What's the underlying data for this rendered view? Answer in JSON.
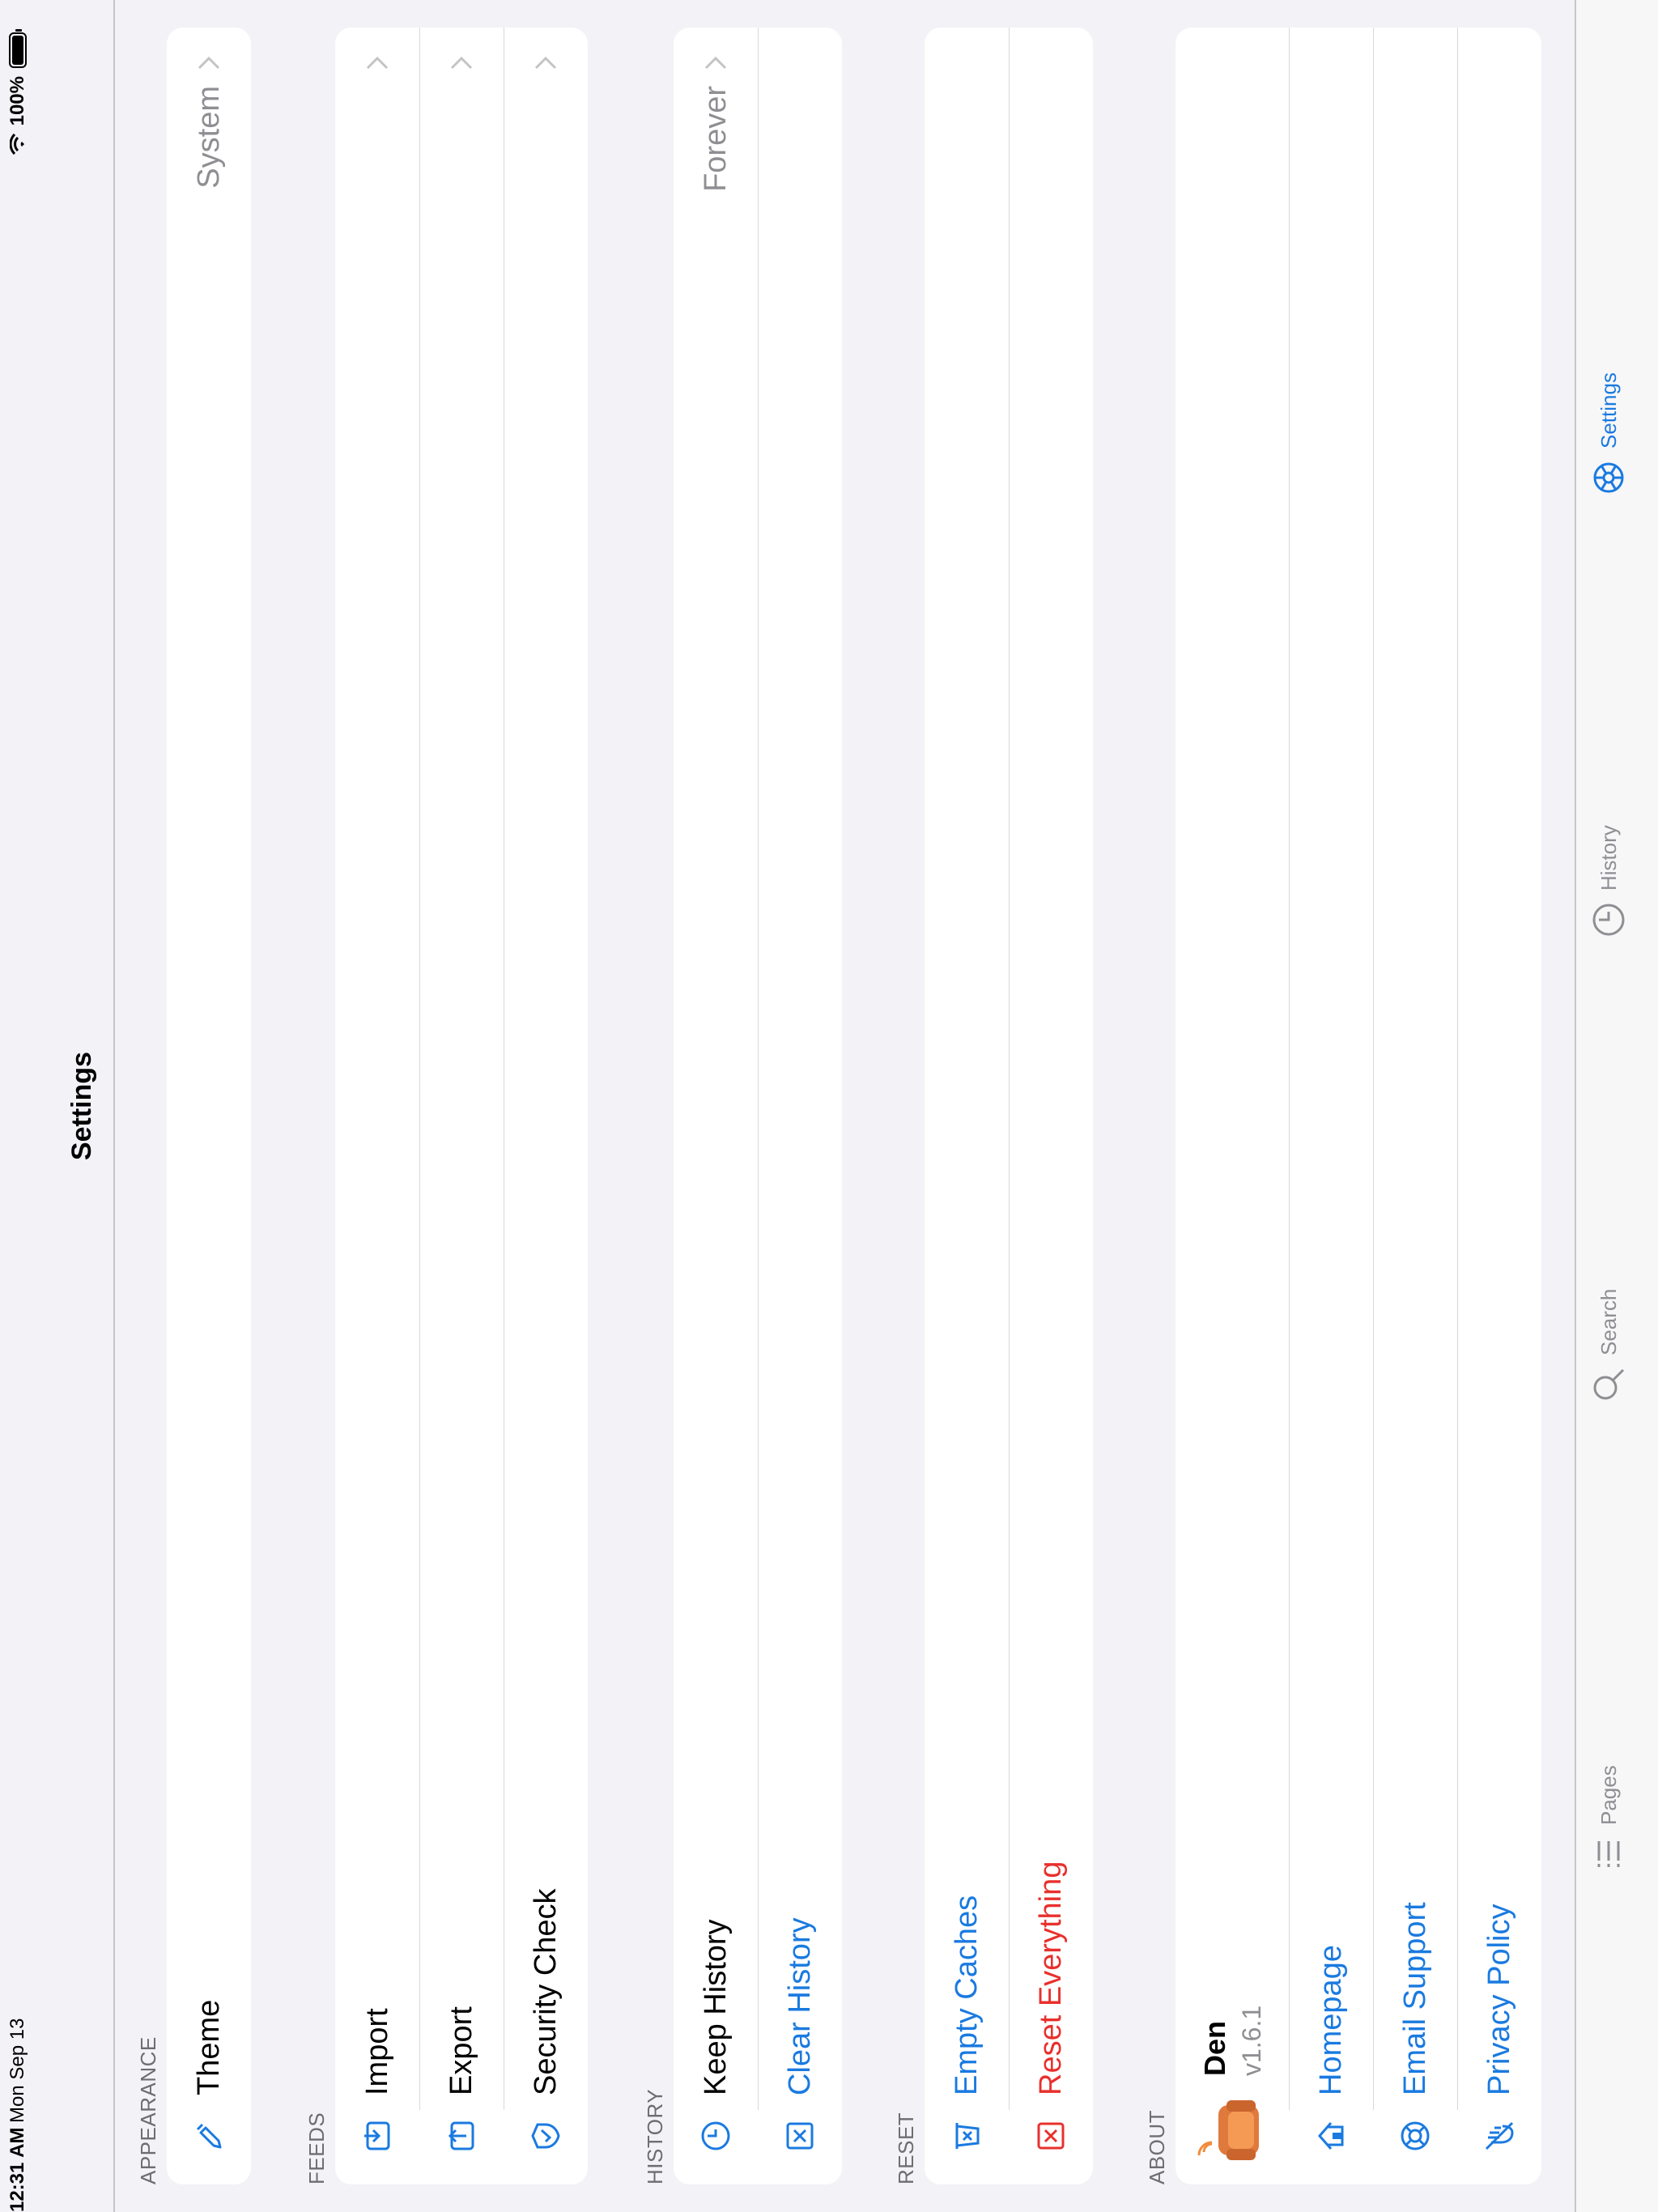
{
  "status_bar": {
    "time": "12:31 AM",
    "date": "Mon Sep 13",
    "battery": "100%"
  },
  "nav": {
    "title": "Settings"
  },
  "sections": {
    "appearance": {
      "header": "APPEARANCE",
      "theme_label": "Theme",
      "theme_value": "System"
    },
    "feeds": {
      "header": "FEEDS",
      "import_label": "Import",
      "export_label": "Export",
      "security_label": "Security Check"
    },
    "history": {
      "header": "HISTORY",
      "keep_label": "Keep History",
      "keep_value": "Forever",
      "clear_label": "Clear History"
    },
    "reset": {
      "header": "RESET",
      "empty_label": "Empty Caches",
      "reset_label": "Reset Everything"
    },
    "about": {
      "header": "ABOUT",
      "app_name": "Den",
      "app_version": "v1.6.1",
      "homepage_label": "Homepage",
      "email_label": "Email Support",
      "privacy_label": "Privacy Policy"
    }
  },
  "tabbar": {
    "pages": "Pages",
    "search": "Search",
    "history": "History",
    "settings": "Settings",
    "active": "settings"
  },
  "colors": {
    "accent": "#1a7ae0",
    "destructive": "#e8302c",
    "background": "#f2f2f7"
  }
}
